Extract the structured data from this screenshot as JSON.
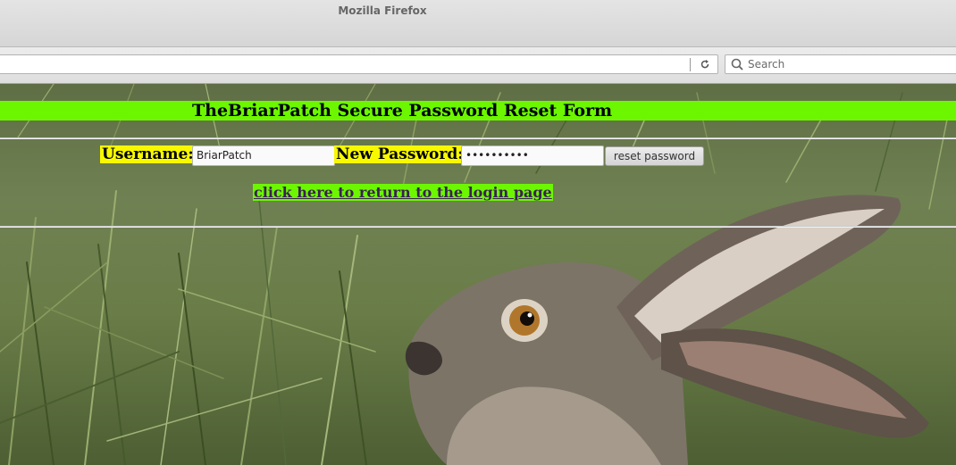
{
  "window": {
    "title": "Mozilla Firefox"
  },
  "toolbar": {
    "search_placeholder": "Search",
    "reload_icon": "reload-icon",
    "search_icon": "search-icon"
  },
  "page": {
    "heading": "TheBriarPatch Secure Password Reset Form",
    "username_label": "Username:",
    "username_value": "BriarPatch",
    "password_label": "New Password:",
    "password_value": "••••••••••",
    "submit_label": "reset password",
    "login_link": "click here to return to the login page"
  },
  "colors": {
    "banner": "#6cf700",
    "label_bg": "#f8f800",
    "link": "#3c1f57"
  }
}
